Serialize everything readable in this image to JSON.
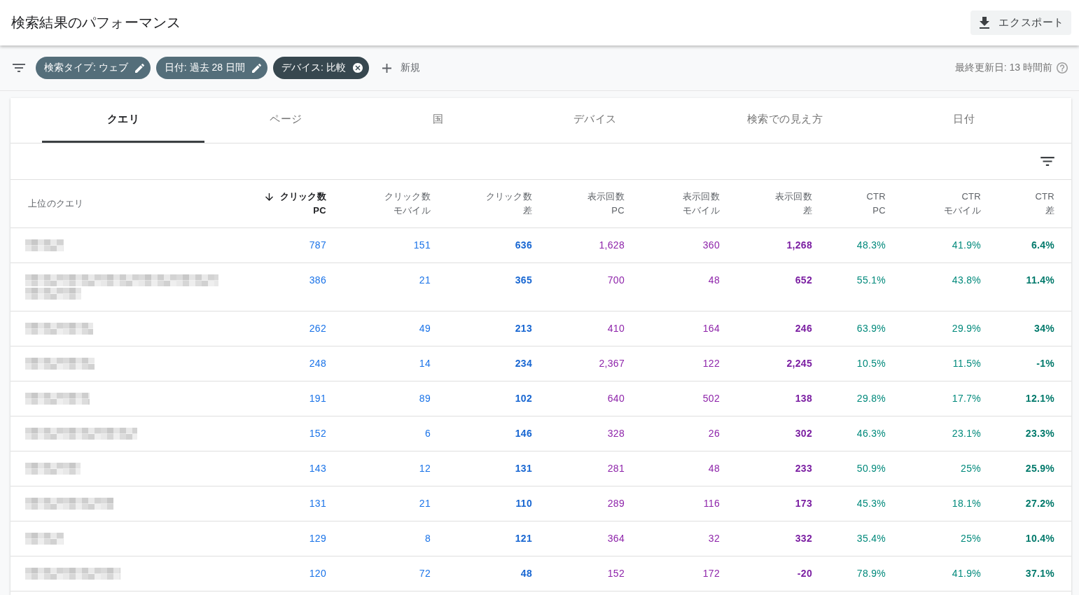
{
  "header": {
    "title": "検索結果のパフォーマンス",
    "export_button": "エクスポート"
  },
  "filter_bar": {
    "chips": [
      {
        "label": "検索タイプ: ウェブ",
        "kind": "editable"
      },
      {
        "label": "日付: 過去 28 日間",
        "kind": "editable"
      },
      {
        "label": "デバイス: 比較",
        "kind": "removable"
      }
    ],
    "new_button": "新規",
    "last_updated": "最終更新日: 13 時間前"
  },
  "tabs": [
    {
      "label": "クエリ",
      "selected": true
    },
    {
      "label": "ページ",
      "selected": false
    },
    {
      "label": "国",
      "selected": false
    },
    {
      "label": "デバイス",
      "selected": false
    },
    {
      "label": "検索での見え方",
      "selected": false
    },
    {
      "label": "日付",
      "selected": false
    }
  ],
  "table": {
    "query_header": "上位のクエリ",
    "columns": [
      {
        "label": "クリック数",
        "sublabel": "PC",
        "kind": "clicks",
        "emphasized": false,
        "sorted": true
      },
      {
        "label": "クリック数",
        "sublabel": "モバイル",
        "kind": "clicks",
        "emphasized": false,
        "sorted": false
      },
      {
        "label": "クリック数",
        "sublabel": "差",
        "kind": "clicks",
        "emphasized": true,
        "sorted": false
      },
      {
        "label": "表示回数",
        "sublabel": "PC",
        "kind": "impressions",
        "emphasized": false,
        "sorted": false
      },
      {
        "label": "表示回数",
        "sublabel": "モバイル",
        "kind": "impressions",
        "emphasized": false,
        "sorted": false
      },
      {
        "label": "表示回数",
        "sublabel": "差",
        "kind": "impressions",
        "emphasized": true,
        "sorted": false
      },
      {
        "label": "CTR",
        "sublabel": "PC",
        "kind": "ctr",
        "emphasized": false,
        "sorted": false
      },
      {
        "label": "CTR",
        "sublabel": "モバイル",
        "kind": "ctr",
        "emphasized": false,
        "sorted": false
      },
      {
        "label": "CTR",
        "sublabel": "差",
        "kind": "ctr",
        "emphasized": true,
        "sorted": false
      }
    ],
    "rows": [
      {
        "cells": [
          "787",
          "151",
          "636",
          "1,628",
          "360",
          "1,268",
          "48.3%",
          "41.9%",
          "6.4%"
        ]
      },
      {
        "cells": [
          "386",
          "21",
          "365",
          "700",
          "48",
          "652",
          "55.1%",
          "43.8%",
          "11.4%"
        ]
      },
      {
        "cells": [
          "262",
          "49",
          "213",
          "410",
          "164",
          "246",
          "63.9%",
          "29.9%",
          "34%"
        ]
      },
      {
        "cells": [
          "248",
          "14",
          "234",
          "2,367",
          "122",
          "2,245",
          "10.5%",
          "11.5%",
          "-1%"
        ]
      },
      {
        "cells": [
          "191",
          "89",
          "102",
          "640",
          "502",
          "138",
          "29.8%",
          "17.7%",
          "12.1%"
        ]
      },
      {
        "cells": [
          "152",
          "6",
          "146",
          "328",
          "26",
          "302",
          "46.3%",
          "23.1%",
          "23.3%"
        ]
      },
      {
        "cells": [
          "143",
          "12",
          "131",
          "281",
          "48",
          "233",
          "50.9%",
          "25%",
          "25.9%"
        ]
      },
      {
        "cells": [
          "131",
          "21",
          "110",
          "289",
          "116",
          "173",
          "45.3%",
          "18.1%",
          "27.2%"
        ]
      },
      {
        "cells": [
          "129",
          "8",
          "121",
          "364",
          "32",
          "332",
          "35.4%",
          "25%",
          "10.4%"
        ]
      },
      {
        "cells": [
          "120",
          "72",
          "48",
          "152",
          "172",
          "-20",
          "78.9%",
          "41.9%",
          "37.1%"
        ]
      }
    ]
  }
}
